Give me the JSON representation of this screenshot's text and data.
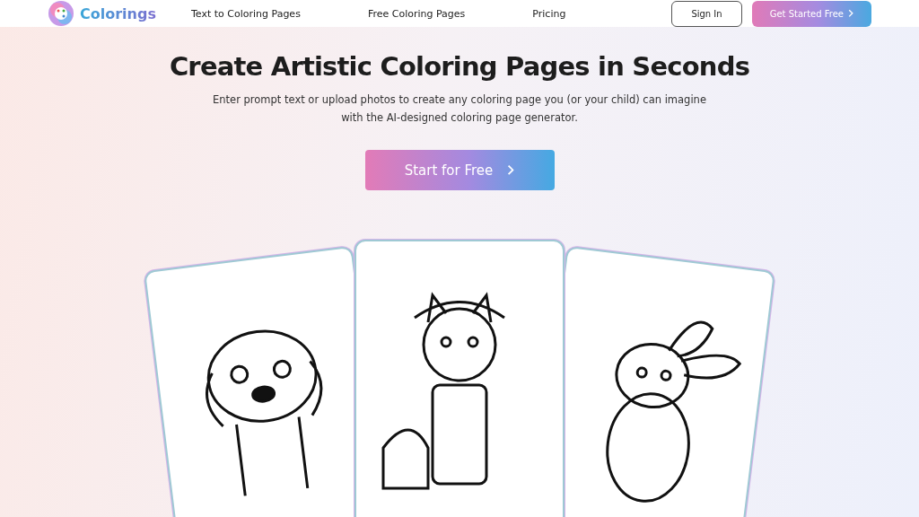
{
  "brand": {
    "name": "Colorings"
  },
  "nav": [
    {
      "label": "Text to Coloring Pages"
    },
    {
      "label": "Free Coloring Pages"
    },
    {
      "label": "Pricing"
    }
  ],
  "header_actions": {
    "sign_in": "Sign In",
    "get_started": "Get Started Free"
  },
  "hero": {
    "title": "Create Artistic Coloring Pages in Seconds",
    "subtitle_lines": [
      "Enter prompt text or upload photos to create any coloring page you (or your child) can imagine",
      "with the AI-designed coloring page generator."
    ],
    "cta": "Start for Free"
  },
  "cards": [
    {
      "kind": "puppy"
    },
    {
      "kind": "cat"
    },
    {
      "kind": "bunny"
    }
  ]
}
